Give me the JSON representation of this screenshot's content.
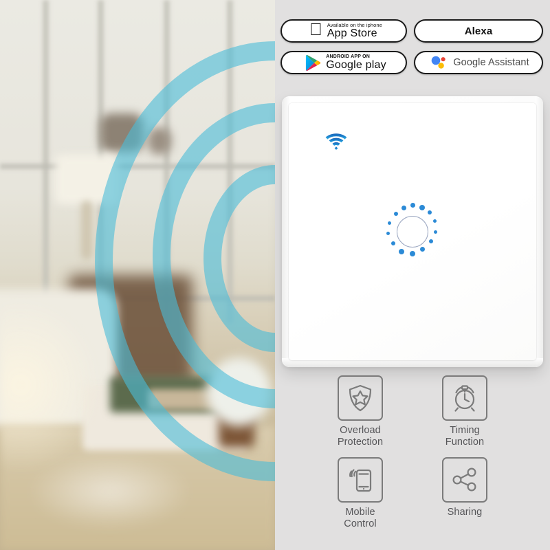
{
  "product": {
    "name": "WiFi Smart Touch Wall Switch",
    "panel": {
      "wifi_icon": "wifi-icon",
      "touch_button_icon": "touch-ring-indicator",
      "panel_color": "#ffffff",
      "indicator_color": "#2b8ad6"
    }
  },
  "scene": {
    "alt": "Blurred living room interior with cyan wireless signal waves",
    "wave_color": "#49bcd8",
    "wave_count": 3
  },
  "badges": [
    {
      "id": "app-store",
      "icon": "apple-icon",
      "subtitle": "Available on the iphone",
      "title": "App  Store"
    },
    {
      "id": "alexa",
      "icon": "none",
      "subtitle": "",
      "title": "Alexa"
    },
    {
      "id": "google-play",
      "icon": "google-play-icon",
      "subtitle": "ANDROID APP ON",
      "title": "Google play"
    },
    {
      "id": "google-assistant",
      "icon": "google-assistant-icon",
      "subtitle": "",
      "title": "Google Assistant"
    }
  ],
  "features": [
    {
      "id": "overload-protection",
      "icon": "shield-star-icon",
      "line1": "Overload",
      "line2": "Protection"
    },
    {
      "id": "timing-function",
      "icon": "alarm-clock-icon",
      "line1": "Timing",
      "line2": "Function"
    },
    {
      "id": "mobile-control",
      "icon": "phone-signal-icon",
      "line1": "Mobile",
      "line2": "Control"
    },
    {
      "id": "sharing",
      "icon": "share-nodes-icon",
      "line1": "Sharing",
      "line2": ""
    }
  ],
  "colors": {
    "background": "#e1e0e0",
    "accent_blue": "#2b8ad6",
    "wave_cyan": "#49bcd8",
    "icon_gray": "#7b7b7b",
    "label_gray": "#555558"
  }
}
